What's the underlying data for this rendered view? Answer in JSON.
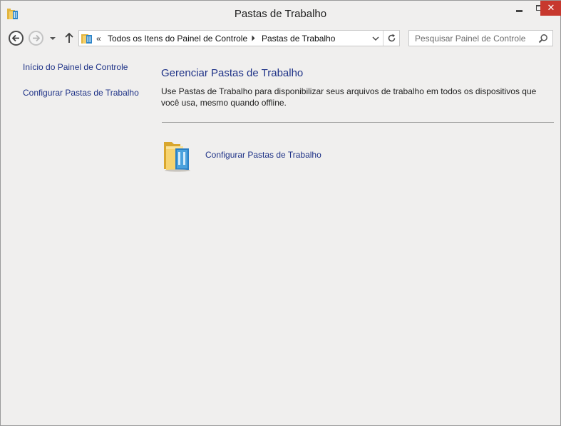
{
  "window": {
    "title": "Pastas de Trabalho",
    "close_glyph": "✕"
  },
  "navigation": {
    "overflow_glyph": "«",
    "breadcrumbs": [
      {
        "label": "Todos os Itens do Painel de Controle"
      },
      {
        "label": "Pastas de Trabalho"
      }
    ],
    "search": {
      "placeholder": "Pesquisar Painel de Controle",
      "value": ""
    }
  },
  "sidebar": {
    "links": [
      {
        "label": "Início do Painel de Controle"
      },
      {
        "label": "Configurar Pastas de Trabalho"
      }
    ]
  },
  "main": {
    "title": "Gerenciar Pastas de Trabalho",
    "description": "Use Pastas de Trabalho para disponibilizar seus arquivos de trabalho em todos os dispositivos que você usa, mesmo quando offline.",
    "tasks": [
      {
        "label": "Configurar Pastas de Trabalho",
        "icon": "work-folders-icon"
      }
    ]
  },
  "colors": {
    "link": "#1e3287",
    "close_button": "#c7382e",
    "window_background": "#f0efee"
  }
}
